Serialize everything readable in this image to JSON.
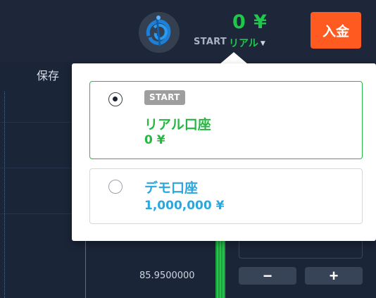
{
  "header": {
    "balance": "0 ¥",
    "account_badge": "START",
    "account_type": "リアル",
    "deposit_label": "入金",
    "avatar_icon": "user-avatar-icon"
  },
  "toolbar": {
    "save_label": "保存"
  },
  "chart": {
    "price_label": "85.9500000"
  },
  "trade_panel": {
    "minus_label": "−",
    "plus_label": "+"
  },
  "account_popup": {
    "real": {
      "badge": "START",
      "name": "リアル口座",
      "balance": "0 ¥",
      "selected": true
    },
    "demo": {
      "name": "デモ口座",
      "balance": "1,000,000 ¥",
      "selected": false
    }
  },
  "colors": {
    "background": "#1b2538",
    "green": "#26b742",
    "blue": "#29a8e0",
    "deposit": "#ff5a1f"
  }
}
